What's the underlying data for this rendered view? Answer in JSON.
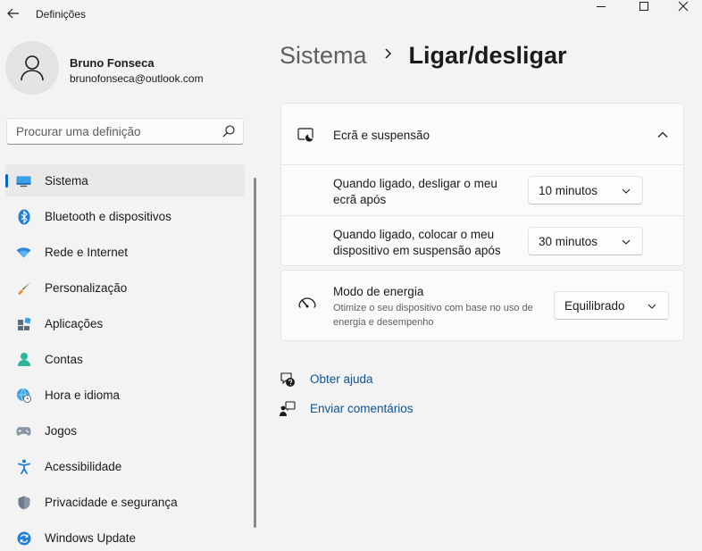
{
  "window": {
    "title": "Definições",
    "controls": [
      "minimize-icon",
      "maximize-icon",
      "close-icon"
    ]
  },
  "profile": {
    "name": "Bruno Fonseca",
    "email": "brunofonseca@outlook.com"
  },
  "search": {
    "placeholder": "Procurar uma definição"
  },
  "sidebar": {
    "items": [
      {
        "label": "Sistema",
        "icon": "monitor-icon",
        "active": true
      },
      {
        "label": "Bluetooth e dispositivos",
        "icon": "bluetooth-icon"
      },
      {
        "label": "Rede e Internet",
        "icon": "wifi-icon"
      },
      {
        "label": "Personalização",
        "icon": "brush-icon"
      },
      {
        "label": "Aplicações",
        "icon": "apps-icon"
      },
      {
        "label": "Contas",
        "icon": "person-icon"
      },
      {
        "label": "Hora e idioma",
        "icon": "globe-clock-icon"
      },
      {
        "label": "Jogos",
        "icon": "gamepad-icon"
      },
      {
        "label": "Acessibilidade",
        "icon": "accessibility-icon"
      },
      {
        "label": "Privacidade e segurança",
        "icon": "shield-icon"
      },
      {
        "label": "Windows Update",
        "icon": "update-icon"
      }
    ]
  },
  "breadcrumb": {
    "parent": "Sistema",
    "current": "Ligar/desligar"
  },
  "screen_sleep": {
    "title": "Ecrã e suspensão",
    "settings": [
      {
        "label": "Quando ligado, desligar o meu ecrã após",
        "value": "10 minutos"
      },
      {
        "label": "Quando ligado, colocar o meu dispositivo em suspensão após",
        "value": "30 minutos"
      }
    ]
  },
  "power_mode": {
    "title": "Modo de energia",
    "description": "Otimize o seu dispositivo com base no uso de energia e desempenho",
    "value": "Equilibrado"
  },
  "links": {
    "help": "Obter ajuda",
    "feedback": "Enviar comentários"
  },
  "colors": {
    "accent": "#0067c0",
    "link": "#0b5394",
    "background": "#f3f3f3",
    "card": "#fbfbfb"
  }
}
